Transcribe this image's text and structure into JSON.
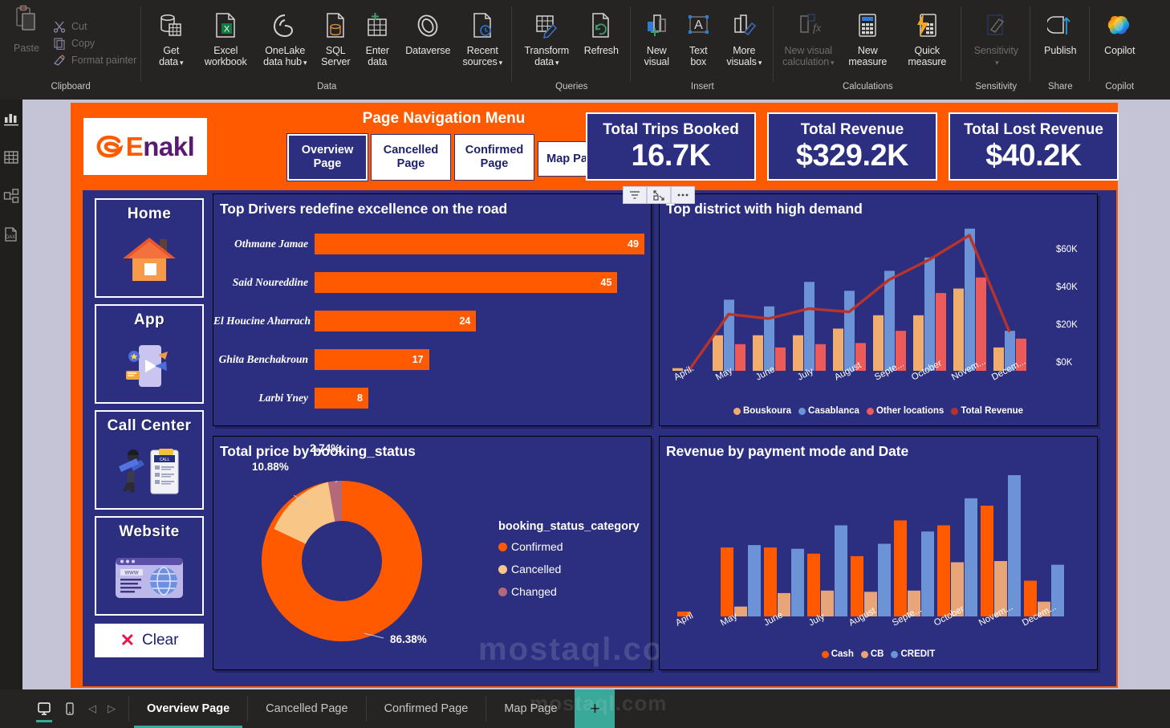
{
  "ribbon": {
    "groups": [
      {
        "label": "Clipboard",
        "paste": "Paste",
        "items": [
          {
            "label": "Cut",
            "icon": "scissors-icon"
          },
          {
            "label": "Copy",
            "icon": "copy-icon"
          },
          {
            "label": "Format painter",
            "icon": "format-painter-icon"
          }
        ]
      },
      {
        "label": "Data",
        "items": [
          {
            "label": "Get\ndata",
            "icon": "get-data-icon",
            "caret": true
          },
          {
            "label": "Excel\nworkbook",
            "icon": "excel-icon",
            "caret": false
          },
          {
            "label": "OneLake\ndata hub",
            "icon": "onelake-icon",
            "caret": true
          },
          {
            "label": "SQL\nServer",
            "icon": "sql-server-icon",
            "caret": false
          },
          {
            "label": "Enter\ndata",
            "icon": "enter-data-icon",
            "caret": false
          },
          {
            "label": "Dataverse",
            "icon": "dataverse-icon",
            "caret": false
          },
          {
            "label": "Recent\nsources",
            "icon": "recent-sources-icon",
            "caret": true
          }
        ]
      },
      {
        "label": "Queries",
        "items": [
          {
            "label": "Transform\ndata",
            "icon": "transform-data-icon",
            "caret": true
          },
          {
            "label": "Refresh",
            "icon": "refresh-icon",
            "caret": false
          }
        ]
      },
      {
        "label": "Insert",
        "items": [
          {
            "label": "New\nvisual",
            "icon": "new-visual-icon",
            "caret": false
          },
          {
            "label": "Text\nbox",
            "icon": "text-box-icon",
            "caret": false
          },
          {
            "label": "More\nvisuals",
            "icon": "more-visuals-icon",
            "caret": true
          }
        ]
      },
      {
        "label": "Calculations",
        "items": [
          {
            "label": "New visual\ncalculation",
            "icon": "new-visual-calculation-icon",
            "caret": true,
            "disabled": true
          },
          {
            "label": "New\nmeasure",
            "icon": "new-measure-icon",
            "caret": false
          },
          {
            "label": "Quick\nmeasure",
            "icon": "quick-measure-icon",
            "caret": false
          }
        ]
      },
      {
        "label": "Sensitivity",
        "items": [
          {
            "label": "Sensitivity",
            "icon": "sensitivity-icon",
            "caret": true,
            "disabled": true
          }
        ]
      },
      {
        "label": "Share",
        "items": [
          {
            "label": "Publish",
            "icon": "publish-icon",
            "caret": false
          }
        ]
      },
      {
        "label": "Copilot",
        "items": [
          {
            "label": "Copilot",
            "icon": "copilot-icon",
            "caret": false
          }
        ]
      }
    ]
  },
  "rail": {
    "items": [
      {
        "name": "report-view-icon",
        "label": "Report"
      },
      {
        "name": "table-view-icon",
        "label": "Table"
      },
      {
        "name": "model-view-icon",
        "label": "Model"
      },
      {
        "name": "dax-query-view-icon",
        "label": "DAX query"
      }
    ]
  },
  "report": {
    "logo": {
      "first": "E",
      "rest": "nakl"
    },
    "nav_title": "Page Navigation Menu",
    "nav_buttons": [
      {
        "label": "Overview\nPage",
        "line1": "Overview",
        "line2": "Page",
        "active": true
      },
      {
        "label": "Cancelled\nPage",
        "line1": "Cancelled",
        "line2": "Page",
        "active": false
      },
      {
        "label": "Confirmed\nPage",
        "line1": "Confirmed",
        "line2": "Page",
        "active": false
      },
      {
        "label": "Map Page",
        "line1": "Map Page",
        "line2": "",
        "active": false
      }
    ],
    "kpis": [
      {
        "title": "Total Trips Booked",
        "value": "16.7K"
      },
      {
        "title": "Total Revenue",
        "value": "$329.2K"
      },
      {
        "title": "Total Lost Revenue",
        "value": "$40.2K"
      }
    ],
    "visual_header": [
      {
        "name": "filter-icon"
      },
      {
        "name": "focus-mode-icon"
      },
      {
        "name": "more-options-icon"
      }
    ],
    "sidebar": {
      "cards": [
        {
          "title": "Home",
          "icon": "house-icon"
        },
        {
          "title": "App",
          "icon": "mobile-app-icon"
        },
        {
          "title": "Call Center",
          "icon": "call-center-icon"
        },
        {
          "title": "Website",
          "icon": "website-icon"
        }
      ],
      "clear_label": "Clear"
    },
    "watermark": "mostaql.com"
  },
  "chart_data": [
    {
      "type": "bar",
      "title": "Top Drivers redefine excellence on the road",
      "orientation": "horizontal",
      "categories": [
        "Othmane Jamae",
        "Said Noureddine",
        "El Houcine Aharrach",
        "Ghita Benchakroun",
        "Larbi Yney"
      ],
      "values": [
        49,
        45,
        24,
        17,
        8
      ],
      "xlabel": "",
      "ylabel": "",
      "xlim": [
        0,
        49
      ],
      "grid": false,
      "bar_color": "#ff5a00",
      "data_labels": true
    },
    {
      "type": "bar",
      "title": "Top district with high demand",
      "subtype": "grouped-column-with-line",
      "categories": [
        "April",
        "May",
        "June",
        "July",
        "August",
        "Septe...",
        "October",
        "Novem...",
        "Decem..."
      ],
      "series": [
        {
          "name": "Bouskoura",
          "color": "#f0ad6e",
          "values": [
            1200,
            16000,
            16000,
            16000,
            19000,
            25000,
            25000,
            37000,
            10500
          ]
        },
        {
          "name": "Casablanca",
          "color": "#6b93d6",
          "values": [
            600,
            32000,
            29000,
            40000,
            36000,
            45000,
            51000,
            64000,
            18000
          ]
        },
        {
          "name": "Other locations",
          "color": "#ed5a5a",
          "values": [
            0,
            12000,
            10500,
            12000,
            12500,
            18000,
            35000,
            42000,
            14500
          ]
        },
        {
          "name": "Total Revenue",
          "color": "#b8332a",
          "type": "line",
          "values": [
            0,
            25500,
            23500,
            28000,
            26500,
            41000,
            50000,
            61000,
            17500
          ]
        }
      ],
      "ylabel": "",
      "xlabel": "",
      "ylim": [
        0,
        65000
      ],
      "yticks": [
        "$0K",
        "$20K",
        "$40K",
        "$60K"
      ],
      "legend_position": "bottom",
      "grid": false
    },
    {
      "type": "pie",
      "subtype": "donut",
      "title": "Total price by booking_status",
      "legend_title": "booking_status_category",
      "labels": [
        "Confirmed",
        "Cancelled",
        "Changed"
      ],
      "values": [
        86.38,
        10.88,
        2.74
      ],
      "display_values": [
        "86.38%",
        "10.88%",
        "2.74%"
      ],
      "colors": [
        "#ff5a00",
        "#f8c687",
        "#b4697a"
      ],
      "legend_position": "right"
    },
    {
      "type": "bar",
      "title": "Revenue by payment mode and Date",
      "subtype": "grouped-column",
      "categories": [
        "April",
        "May",
        "June",
        "July",
        "August",
        "Septe...",
        "October",
        "Novem...",
        "Decem..."
      ],
      "series": [
        {
          "name": "Cash",
          "color": "#ff5a00",
          "values": [
            2000,
            28000,
            28000,
            25500,
            24500,
            39000,
            37000,
            45000,
            14500
          ]
        },
        {
          "name": "CB",
          "color": "#e8a577",
          "values": [
            0,
            4000,
            9500,
            10500,
            10000,
            10500,
            22000,
            22500,
            6000
          ]
        },
        {
          "name": "CREDIT",
          "color": "#6b93d6",
          "values": [
            0,
            29000,
            27500,
            37000,
            29500,
            34500,
            48000,
            57000,
            21000
          ]
        }
      ],
      "ylabel": "",
      "xlabel": "",
      "ylim": [
        0,
        60000
      ],
      "legend_position": "bottom",
      "grid": false
    }
  ],
  "tabbar": {
    "view_icons": [
      {
        "name": "desktop-layout-icon",
        "selected": true
      },
      {
        "name": "mobile-layout-icon",
        "selected": false
      }
    ],
    "prev_label": "◁",
    "next_label": "▷",
    "tabs": [
      {
        "label": "Overview Page",
        "active": true
      },
      {
        "label": "Cancelled Page",
        "active": false
      },
      {
        "label": "Confirmed Page",
        "active": false
      },
      {
        "label": "Map Page",
        "active": false
      }
    ],
    "add_label": "+",
    "watermark": "mostaql.com"
  }
}
